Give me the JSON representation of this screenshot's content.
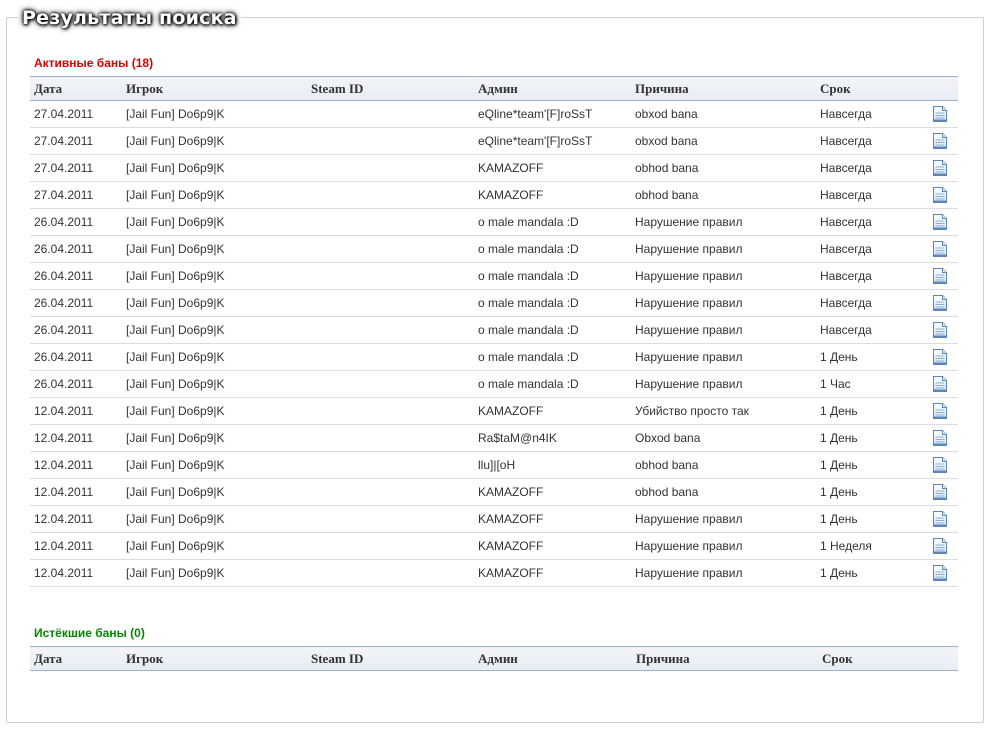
{
  "page": {
    "title": "Результаты поиска"
  },
  "columns": {
    "date": "Дата",
    "player": "Игрок",
    "steam_id": "Steam ID",
    "admin": "Админ",
    "reason": "Причина",
    "term": "Срок"
  },
  "active": {
    "title": "Активные баны (18)",
    "rows": [
      {
        "date": "27.04.2011",
        "player": "[Jail Fun] Do6p9|K",
        "steam_id": "",
        "admin": "eQline*team'[F]roSsT",
        "reason": "obxod bana",
        "term": "Навсегда"
      },
      {
        "date": "27.04.2011",
        "player": "[Jail Fun] Do6p9|K",
        "steam_id": "",
        "admin": "eQline*team'[F]roSsT",
        "reason": "obxod bana",
        "term": "Навсегда"
      },
      {
        "date": "27.04.2011",
        "player": "[Jail Fun] Do6p9|K",
        "steam_id": "",
        "admin": "KAMAZOFF",
        "reason": "obhod bana",
        "term": "Навсегда"
      },
      {
        "date": "27.04.2011",
        "player": "[Jail Fun] Do6p9|K",
        "steam_id": "",
        "admin": "KAMAZOFF",
        "reason": "obhod bana",
        "term": "Навсегда"
      },
      {
        "date": "26.04.2011",
        "player": "[Jail Fun] Do6p9|K",
        "steam_id": "",
        "admin": "o male mandala :D",
        "reason": "Нарушение правил",
        "term": "Навсегда"
      },
      {
        "date": "26.04.2011",
        "player": "[Jail Fun] Do6p9|K",
        "steam_id": "",
        "admin": "o male mandala :D",
        "reason": "Нарушение правил",
        "term": "Навсегда"
      },
      {
        "date": "26.04.2011",
        "player": "[Jail Fun] Do6p9|K",
        "steam_id": "",
        "admin": "o male mandala :D",
        "reason": "Нарушение правил",
        "term": "Навсегда"
      },
      {
        "date": "26.04.2011",
        "player": "[Jail Fun] Do6p9|K",
        "steam_id": "",
        "admin": "o male mandala :D",
        "reason": "Нарушение правил",
        "term": "Навсегда"
      },
      {
        "date": "26.04.2011",
        "player": "[Jail Fun] Do6p9|K",
        "steam_id": "",
        "admin": "o male mandala :D",
        "reason": "Нарушение правил",
        "term": "Навсегда"
      },
      {
        "date": "26.04.2011",
        "player": "[Jail Fun] Do6p9|K",
        "steam_id": "",
        "admin": "o male mandala :D",
        "reason": "Нарушение правил",
        "term": "1 День"
      },
      {
        "date": "26.04.2011",
        "player": "[Jail Fun] Do6p9|K",
        "steam_id": "",
        "admin": "o male mandala :D",
        "reason": "Нарушение правил",
        "term": "1 Час"
      },
      {
        "date": "12.04.2011",
        "player": "[Jail Fun] Do6p9|K",
        "steam_id": "",
        "admin": "KAMAZOFF",
        "reason": "Убийство просто так",
        "term": "1 День"
      },
      {
        "date": "12.04.2011",
        "player": "[Jail Fun] Do6p9|K",
        "steam_id": "",
        "admin": "Ra$taM@n4IK",
        "reason": "Obxod bana",
        "term": "1 День"
      },
      {
        "date": "12.04.2011",
        "player": "[Jail Fun] Do6p9|K",
        "steam_id": "",
        "admin": "llu]|[oH",
        "reason": "obhod bana",
        "term": "1 День"
      },
      {
        "date": "12.04.2011",
        "player": "[Jail Fun] Do6p9|K",
        "steam_id": "",
        "admin": "KAMAZOFF",
        "reason": "obhod bana",
        "term": "1 День"
      },
      {
        "date": "12.04.2011",
        "player": "[Jail Fun] Do6p9|K",
        "steam_id": "",
        "admin": "KAMAZOFF",
        "reason": "Нарушение правил",
        "term": "1 День"
      },
      {
        "date": "12.04.2011",
        "player": "[Jail Fun] Do6p9|K",
        "steam_id": "",
        "admin": "KAMAZOFF",
        "reason": "Нарушение правил",
        "term": "1 Неделя"
      },
      {
        "date": "12.04.2011",
        "player": "[Jail Fun] Do6p9|K",
        "steam_id": "",
        "admin": "KAMAZOFF",
        "reason": "Нарушение правил",
        "term": "1 День"
      }
    ]
  },
  "expired": {
    "title": "Истёкшие баны (0)",
    "rows": []
  },
  "icons": {
    "row_details": "document-icon"
  },
  "colors": {
    "active_title": "#dd0000",
    "expired_title": "#008800",
    "header_border": "#9db0ce",
    "header_bg": "#e8ecf3"
  }
}
